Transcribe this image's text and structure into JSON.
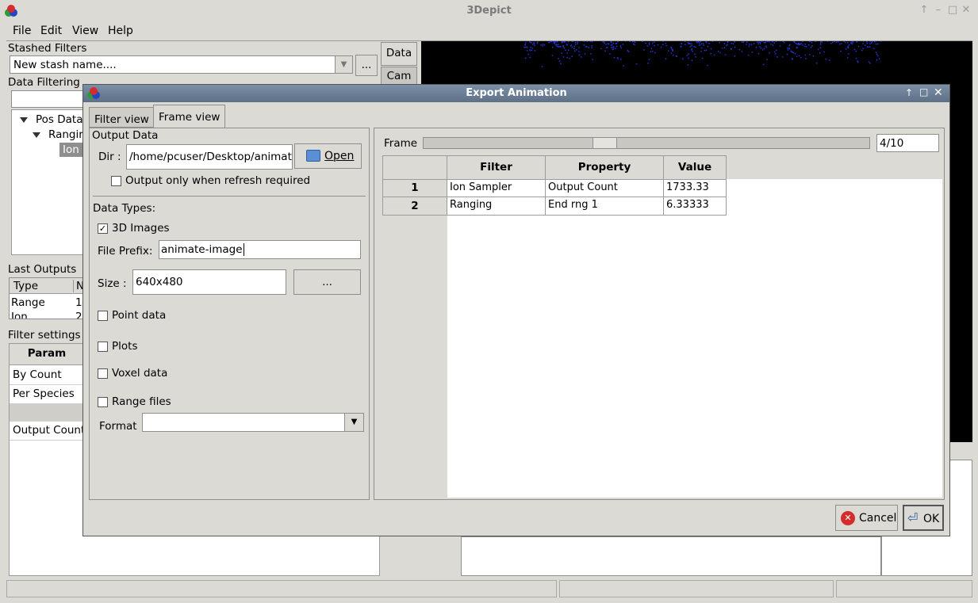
{
  "window": {
    "title": "3Depict"
  },
  "menubar": {
    "items": [
      "File",
      "Edit",
      "View",
      "Help"
    ]
  },
  "left_panel": {
    "stashed_filters_label": "Stashed Filters",
    "stash_name_value": "New stash name....",
    "stash_more_button": "...",
    "data_button": "Data",
    "cam_button": "Cam",
    "data_filtering_label": "Data Filtering",
    "tree": {
      "pos_data": "Pos Data",
      "ranging": "Rangir",
      "ion": "Ion"
    },
    "last_outputs_label": "Last Outputs",
    "outputs_columns": [
      "Type",
      "N"
    ],
    "outputs_rows": [
      [
        "Range",
        "1"
      ],
      [
        "Ion",
        "2"
      ]
    ],
    "filter_settings_label": "Filter settings",
    "param_header": "Param",
    "params": [
      "By Count",
      "Per Species",
      "",
      "Output Count"
    ]
  },
  "dialog": {
    "title": "Export Animation",
    "tabs": [
      "Filter view",
      "Frame view"
    ],
    "output_data_label": "Output Data",
    "dir_label": "Dir :",
    "dir_value": "/home/pcuser/Desktop/animatic",
    "open_button": "Open",
    "refresh_only_label": "Output only when refresh required",
    "refresh_only_checked": false,
    "data_types_label": "Data Types:",
    "images_label": "3D Images",
    "images_checked": true,
    "file_prefix_label": "File Prefix:",
    "file_prefix_value": "animate-image",
    "size_label": "Size :",
    "size_value": "640x480",
    "size_button": "...",
    "point_data_label": "Point data",
    "plots_label": "Plots",
    "voxel_data_label": "Voxel data",
    "range_files_label": "Range files",
    "format_label": "Format",
    "format_value": "",
    "frame_label": "Frame",
    "frame_value": "4/10",
    "frame_fraction": 0.4,
    "table": {
      "columns": [
        "Filter",
        "Property",
        "Value"
      ],
      "rows": [
        {
          "index": "1",
          "filter": "Ion Sampler",
          "property": "Output Count",
          "value": "1733.33"
        },
        {
          "index": "2",
          "filter": "Ranging",
          "property": "End rng 1",
          "value": "6.33333"
        }
      ]
    },
    "cancel_button": "Cancel",
    "ok_button": "OK"
  },
  "colors": {
    "dialog_titlebar": "#6a7e96",
    "gl_background": "#000000",
    "points": "#2233cc"
  }
}
